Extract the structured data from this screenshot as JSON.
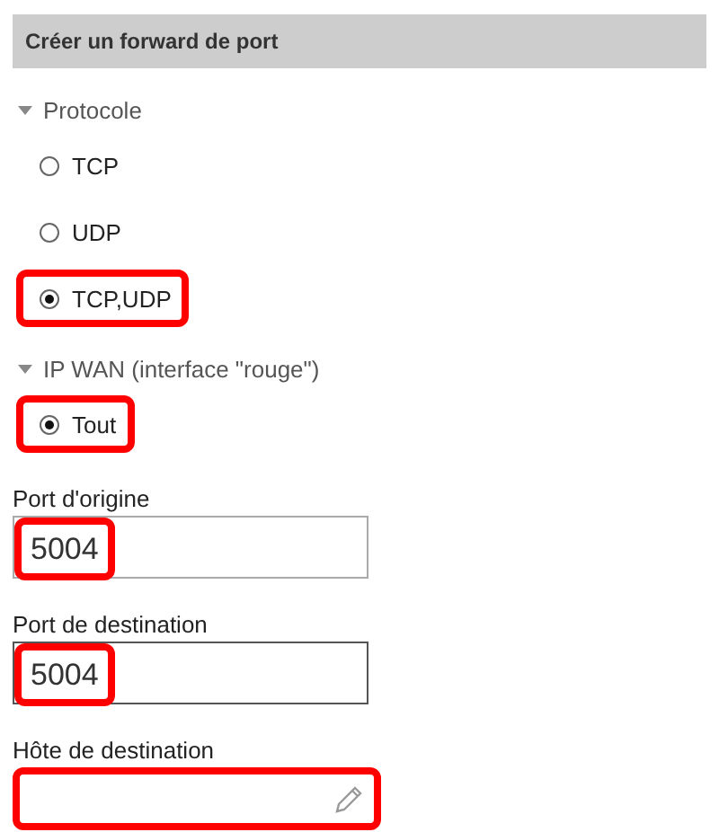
{
  "header": {
    "title": "Créer un forward de port"
  },
  "sections": [
    {
      "title": "Protocole",
      "expanded": true,
      "options": [
        {
          "label": "TCP",
          "selected": false,
          "highlighted": false
        },
        {
          "label": "UDP",
          "selected": false,
          "highlighted": false
        },
        {
          "label": "TCP,UDP",
          "selected": true,
          "highlighted": true
        }
      ]
    },
    {
      "title": "IP WAN (interface \"rouge\")",
      "expanded": true,
      "options": [
        {
          "label": "Tout",
          "selected": true,
          "highlighted": true
        }
      ]
    }
  ],
  "fields": [
    {
      "label": "Port d'origine",
      "value": "5004",
      "focused": false,
      "highlighted": true,
      "kind": "text"
    },
    {
      "label": "Port de destination",
      "value": "5004",
      "focused": true,
      "highlighted": true,
      "kind": "text"
    },
    {
      "label": "Hôte de destination",
      "focused": false,
      "highlighted": true,
      "kind": "edit"
    }
  ]
}
